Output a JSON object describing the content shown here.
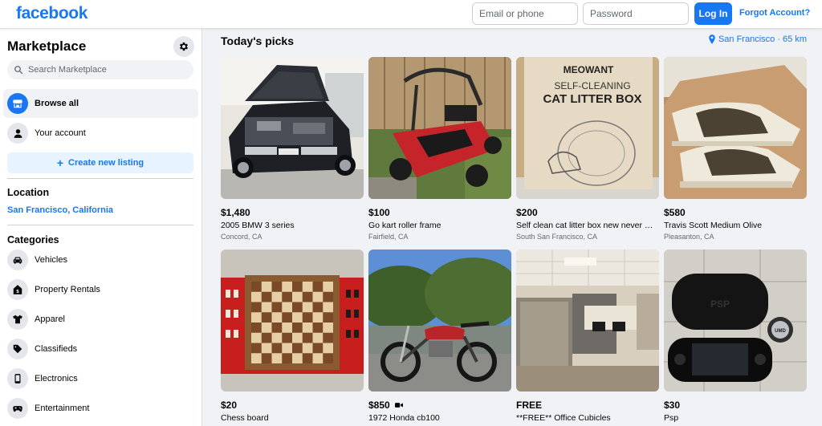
{
  "header": {
    "logo": "facebook",
    "email_placeholder": "Email or phone",
    "password_placeholder": "Password",
    "login_label": "Log In",
    "forgot_label": "Forgot Account?"
  },
  "sidebar": {
    "title": "Marketplace",
    "search_placeholder": "Search Marketplace",
    "nav": [
      {
        "label": "Browse all",
        "icon": "storefront-icon"
      },
      {
        "label": "Your account",
        "icon": "person-icon"
      }
    ],
    "create_listing": "Create new listing",
    "location_title": "Location",
    "location_value": "San Francisco, California",
    "categories_title": "Categories",
    "categories": [
      {
        "label": "Vehicles",
        "icon": "car-icon"
      },
      {
        "label": "Property Rentals",
        "icon": "house-dollar-icon"
      },
      {
        "label": "Apparel",
        "icon": "shirt-icon"
      },
      {
        "label": "Classifieds",
        "icon": "tag-icon"
      },
      {
        "label": "Electronics",
        "icon": "phone-icon"
      },
      {
        "label": "Entertainment",
        "icon": "gamepad-icon"
      }
    ]
  },
  "main": {
    "title": "Today's picks",
    "location": "San Francisco · 65 km",
    "listings": [
      {
        "price": "$1,480",
        "title": "2005 BMW 3 series",
        "location": "Concord, CA",
        "image": "car-photo"
      },
      {
        "price": "$100",
        "title": "Go kart roller frame",
        "location": "Fairfield, CA",
        "image": "go-kart-photo"
      },
      {
        "price": "$200",
        "title": "Self clean cat litter box new never …",
        "location": "South San Francisco, CA",
        "image": "litter-box-photo",
        "box_brand": "MEOWANT",
        "box_line1": "SELF-CLEANING",
        "box_line2": "CAT LITTER BOX"
      },
      {
        "price": "$580",
        "title": "Travis Scott Medium Olive",
        "location": "Pleasanton, CA",
        "image": "sneakers-photo"
      },
      {
        "price": "$20",
        "title": "Chess board",
        "location": "",
        "image": "chess-board-photo"
      },
      {
        "price": "$850",
        "title": "1972 Honda cb100",
        "location": "",
        "image": "motorcycle-photo",
        "has_video": true
      },
      {
        "price": "FREE",
        "title": "**FREE** Office Cubicles",
        "location": "",
        "image": "office-photo"
      },
      {
        "price": "$30",
        "title": "Psp",
        "location": "",
        "image": "psp-photo",
        "psp_label": "PSP",
        "umd_label": "UMD"
      }
    ]
  },
  "colors": {
    "brand": "#1877f2",
    "background": "#f0f2f5",
    "text": "#050505",
    "secondary_text": "#65676b"
  }
}
